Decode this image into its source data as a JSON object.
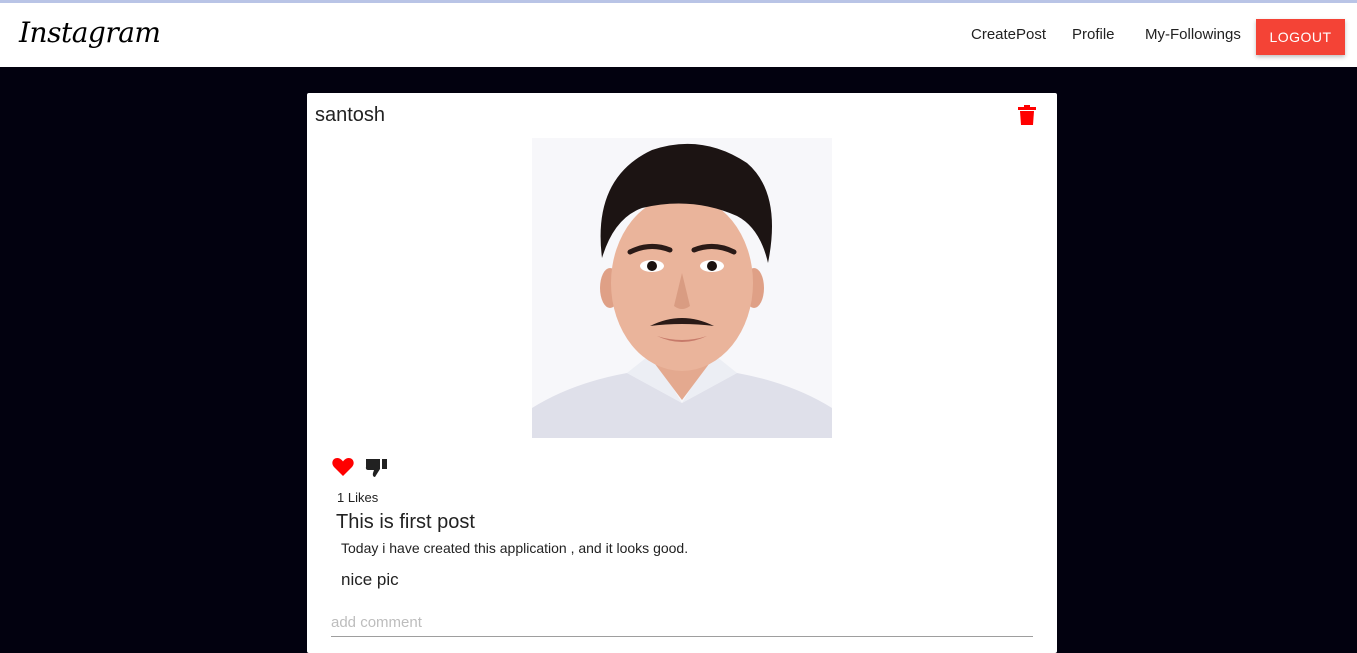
{
  "nav": {
    "brand": "Instagram",
    "links": [
      "CreatePost",
      "Profile",
      "My-Followings"
    ],
    "logout_label": "LOGOUT"
  },
  "post": {
    "author": "santosh",
    "likes_text": "1 Likes",
    "title": "This is first post",
    "body": "Today i have created this application , and it looks good.",
    "comment": "nice pic",
    "comment_placeholder": "add comment"
  },
  "colors": {
    "page_background": "#02010f",
    "logout_button": "#f44336",
    "delete_icon": "#ff0000",
    "heart_icon": "#ff0000"
  },
  "icons": [
    "delete-icon",
    "heart-icon",
    "thumbs-down-icon"
  ]
}
